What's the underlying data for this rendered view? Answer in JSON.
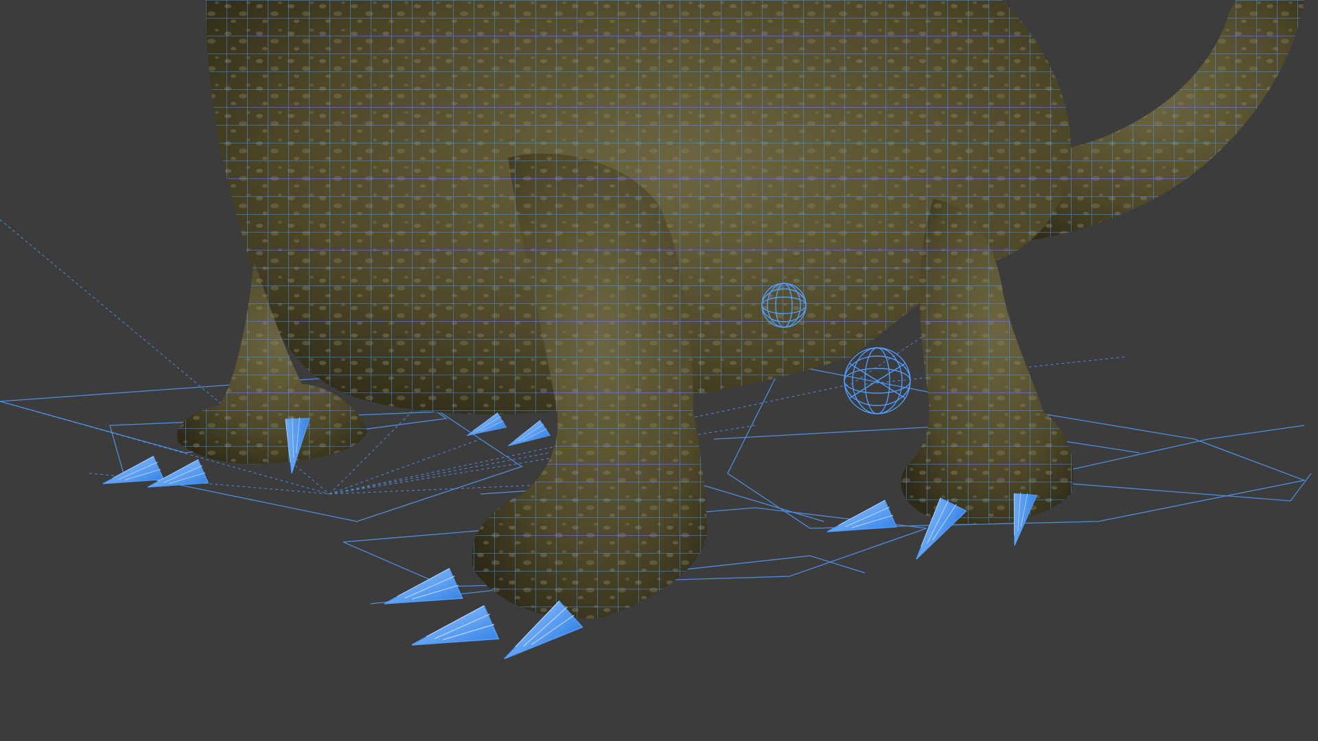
{
  "viewport": {
    "background_color": "#3c3c3c",
    "wire_color": "#4f9dff",
    "claw_color": "#6fb4ff",
    "skin_color": "#5f5836",
    "skin_dark_color": "#2d2a18",
    "skin_spot_color": "#8c8360",
    "subject": "wireframe-dinosaur-legs-with-claws",
    "shading": "textured-with-wireframe-overlay"
  }
}
